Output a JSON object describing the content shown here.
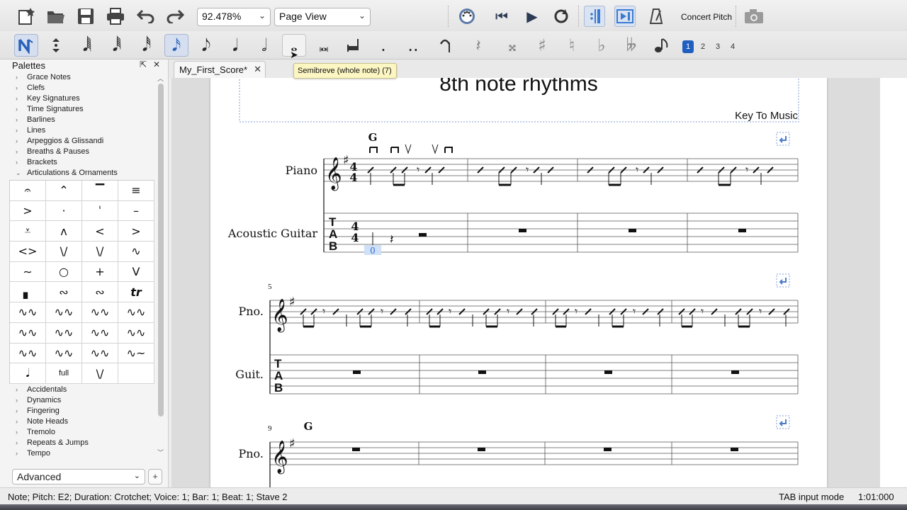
{
  "toolbar": {
    "zoom_value": "92.478%",
    "view_mode": "Page View",
    "concert_pitch_label": "Concert Pitch"
  },
  "tooltip": {
    "text": "Semibreve (whole note) (7)"
  },
  "voices": [
    "1",
    "2",
    "3",
    "4"
  ],
  "palettes": {
    "title": "Palettes",
    "sections_top": [
      "Grace Notes",
      "Clefs",
      "Key Signatures",
      "Time Signatures",
      "Barlines",
      "Lines",
      "Arpeggios & Glissandi",
      "Breaths & Pauses",
      "Brackets",
      "Articulations & Ornaments"
    ],
    "sections_bottom": [
      "Accidentals",
      "Dynamics",
      "Fingering",
      "Note Heads",
      "Tremolo",
      "Repeats & Jumps",
      "Tempo"
    ],
    "grid_cells": [
      "𝄐",
      "⌃",
      "▔",
      "≡",
      ">",
      "·",
      "ˈ",
      "–",
      "⩡",
      "ᴧ",
      "<",
      ">",
      "<>",
      "\\/",
      "\\/",
      "∿",
      "∼",
      "○",
      "+",
      "V",
      "▖",
      "∾",
      "∾",
      "tr",
      "∿∿",
      "∿∿",
      "∿∿",
      "∿∿",
      "∿∿",
      "∿∿",
      "∿∿",
      "∿∿",
      "∿∿",
      "∿∿",
      "∿∿",
      "∿~",
      "𝅘𝅥",
      "full",
      "\\/",
      ""
    ],
    "advanced_label": "Advanced"
  },
  "document": {
    "tab_label": "My_First_Score*"
  },
  "score": {
    "title": "8th note rhythms",
    "composer": "Key To Music",
    "instruments": [
      "Piano",
      "Acoustic Guitar"
    ],
    "short_names": [
      "Pno.",
      "Guit."
    ],
    "chord_symbol": "G",
    "time_signature": "4\n4",
    "tab_clef": "T\nA\nB",
    "fret_number": "0",
    "measure_numbers": [
      "5",
      "9"
    ]
  },
  "status": {
    "left": "Note; Pitch: E2; Duration: Crotchet; Voice: 1;  Bar: 1; Beat: 1; Stave 2",
    "mode": "TAB input mode",
    "time": "1:01:000"
  }
}
